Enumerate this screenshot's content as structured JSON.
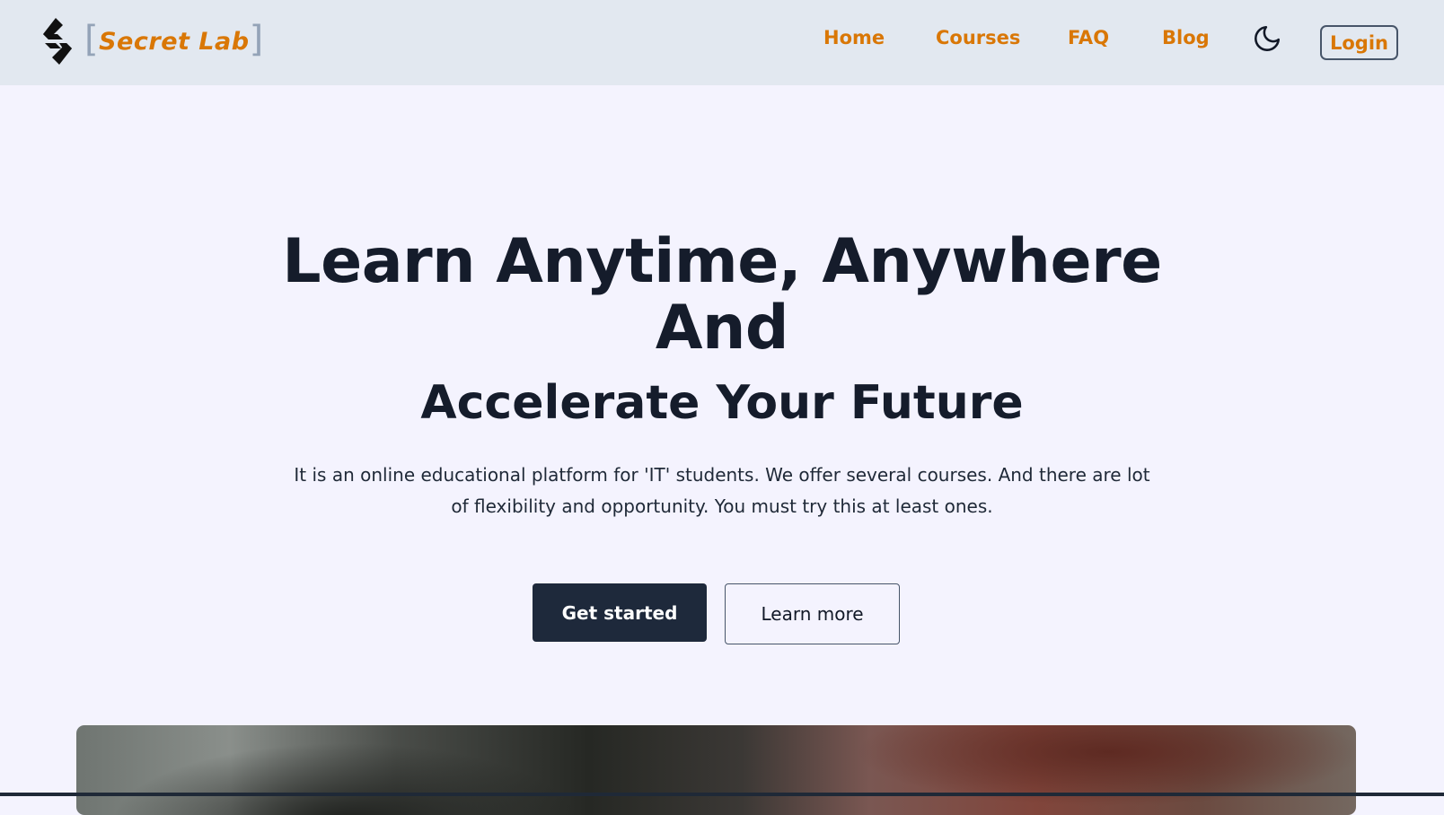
{
  "brand": {
    "name": "Secret Lab",
    "accent_color": "#d97706",
    "logo_icon": "code-brackets-logo-icon"
  },
  "nav": {
    "items": [
      {
        "label": "Home"
      },
      {
        "label": "Courses"
      },
      {
        "label": "FAQ"
      },
      {
        "label": "Blog"
      }
    ],
    "theme_toggle_icon": "moon-icon",
    "login_label": "Login"
  },
  "hero": {
    "title_line1": "Learn Anytime, Anywhere",
    "title_line2": "And",
    "subtitle": "Accelerate Your Future",
    "description": "It is an online educational platform for 'IT' students. We offer several courses. And there are lot of flexibility and opportunity. You must try this at least ones.",
    "primary_button": "Get started",
    "secondary_button": "Learn more",
    "text_color": "#151c2b",
    "primary_button_color": "#1e293b"
  },
  "page": {
    "background_color": "#f4f3fe",
    "navbar_color": "#e2e8f0"
  }
}
